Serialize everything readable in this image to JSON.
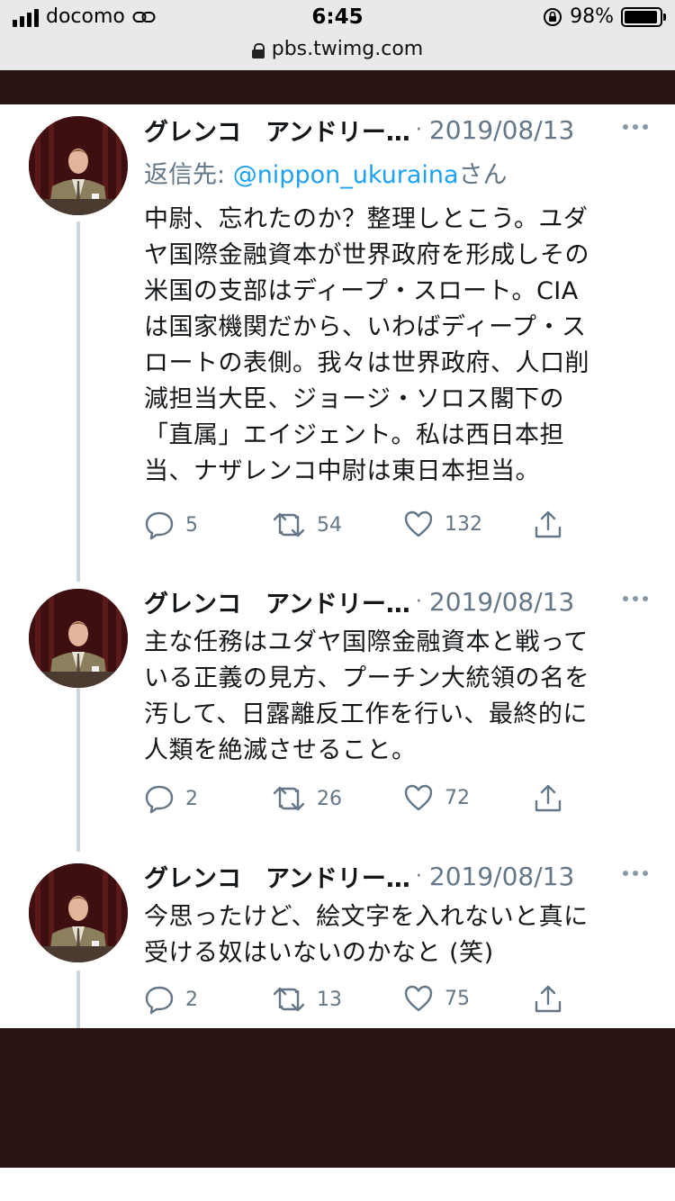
{
  "status_bar": {
    "carrier": "docomo",
    "time": "6:45",
    "battery": "98%",
    "battery_level": 0.98
  },
  "browser": {
    "url": "pbs.twimg.com"
  },
  "tweets": [
    {
      "name": "グレンコ　アンドリー…",
      "date": "2019/08/13",
      "reply_prefix": "返信先: ",
      "reply_handle": "@nippon_ukuraina",
      "reply_suffix": "さん",
      "lines": [
        "中尉、忘れたのか？整理しとこう。ユダ",
        "ヤ国際金融資本が世界政府を形成しその",
        "米国の支部はディープ・スロート。CIA",
        "は国家機関だから、いわばディープ・ス",
        "ロートの表側。我々は世界政府、人口削",
        "減担当大臣、ジョージ・ソロス閣下の",
        "「直属」エイジェント。私は西日本担",
        "当、ナザレンコ中尉は東日本担当。"
      ],
      "replies": "5",
      "retweets": "54",
      "likes": "132"
    },
    {
      "name": "グレンコ　アンドリー…",
      "date": "2019/08/13",
      "lines": [
        "主な任務はユダヤ国際金融資本と戦って",
        "いる正義の見方、プーチン大統領の名を",
        "汚して、日露離反工作を行い、最終的に",
        "人類を絶滅させること。"
      ],
      "replies": "2",
      "retweets": "26",
      "likes": "72"
    },
    {
      "name": "グレンコ　アンドリー…",
      "date": "2019/08/13",
      "lines": [
        "今思ったけど、絵文字を入れないと真に",
        "受ける奴はいないのかなと (笑)"
      ],
      "replies": "2",
      "retweets": "13",
      "likes": "75"
    }
  ],
  "icons": {
    "reply": "reply-icon",
    "retweet": "retweet-icon",
    "like": "heart-icon",
    "share": "share-icon",
    "more": "more-icon",
    "lock": "lock-icon"
  },
  "colors": {
    "link": "#1da1f2",
    "muted": "#657786",
    "thread_line": "#ccd6dd",
    "band": "#2a1414"
  }
}
